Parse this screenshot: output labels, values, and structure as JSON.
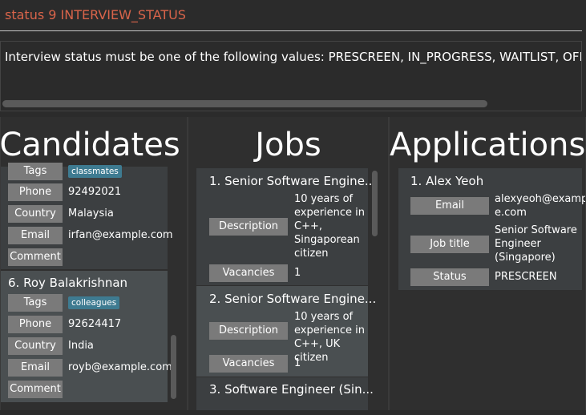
{
  "command": {
    "input": "status 9 INTERVIEW_STATUS"
  },
  "result": {
    "message": "Interview status must be one of the following values: PRESCREEN, IN_PROGRESS, WAITLIST, OFFE"
  },
  "candidates": {
    "title": "Candidates",
    "partial_card": {
      "tags_label": "Tags",
      "tag": "classmates",
      "phone_label": "Phone",
      "phone": "92492021",
      "country_label": "Country",
      "country": "Malaysia",
      "email_label": "Email",
      "email": "irfan@example.com",
      "comment_label": "Comment"
    },
    "card6": {
      "title": "6.  Roy Balakrishnan",
      "tags_label": "Tags",
      "tag": "colleagues",
      "phone_label": "Phone",
      "phone": "92624417",
      "country_label": "Country",
      "country": "India",
      "email_label": "Email",
      "email": "royb@example.com",
      "comment_label": "Comment"
    }
  },
  "jobs": {
    "title": "Jobs",
    "job1": {
      "title": "1.  Senior Software Engine...",
      "desc_label": "Description",
      "desc_lines": [
        "10 years of",
        "experience in",
        "C++,",
        "Singaporean",
        "citizen"
      ],
      "vac_label": "Vacancies",
      "vacancies": "1"
    },
    "job2": {
      "title": "2.  Senior Software Engine...",
      "desc_label": "Description",
      "desc_lines": [
        "10 years of",
        "experience in",
        "C++, UK citizen"
      ],
      "vac_label": "Vacancies",
      "vacancies": "1"
    },
    "job3": {
      "title": "3.  Software Engineer (Sin..."
    }
  },
  "applications": {
    "title": "Applications",
    "app1": {
      "title": "1.  Alex Yeoh",
      "email_label": "Email",
      "email_lines": [
        "alexyeoh@exampl",
        "e.com"
      ],
      "job_label": "Job title",
      "job_lines": [
        "Senior Software",
        "Engineer",
        "(Singapore)"
      ],
      "status_label": "Status",
      "status": "PRESCREEN"
    }
  },
  "colors": {
    "background": "#2b2b2b",
    "command_text": "#d9644a",
    "label_bg": "#7a7a7a",
    "tag_bg": "#3e7b91",
    "card_bg": "#3c3f41",
    "selected_card_bg": "#4a4f51"
  }
}
